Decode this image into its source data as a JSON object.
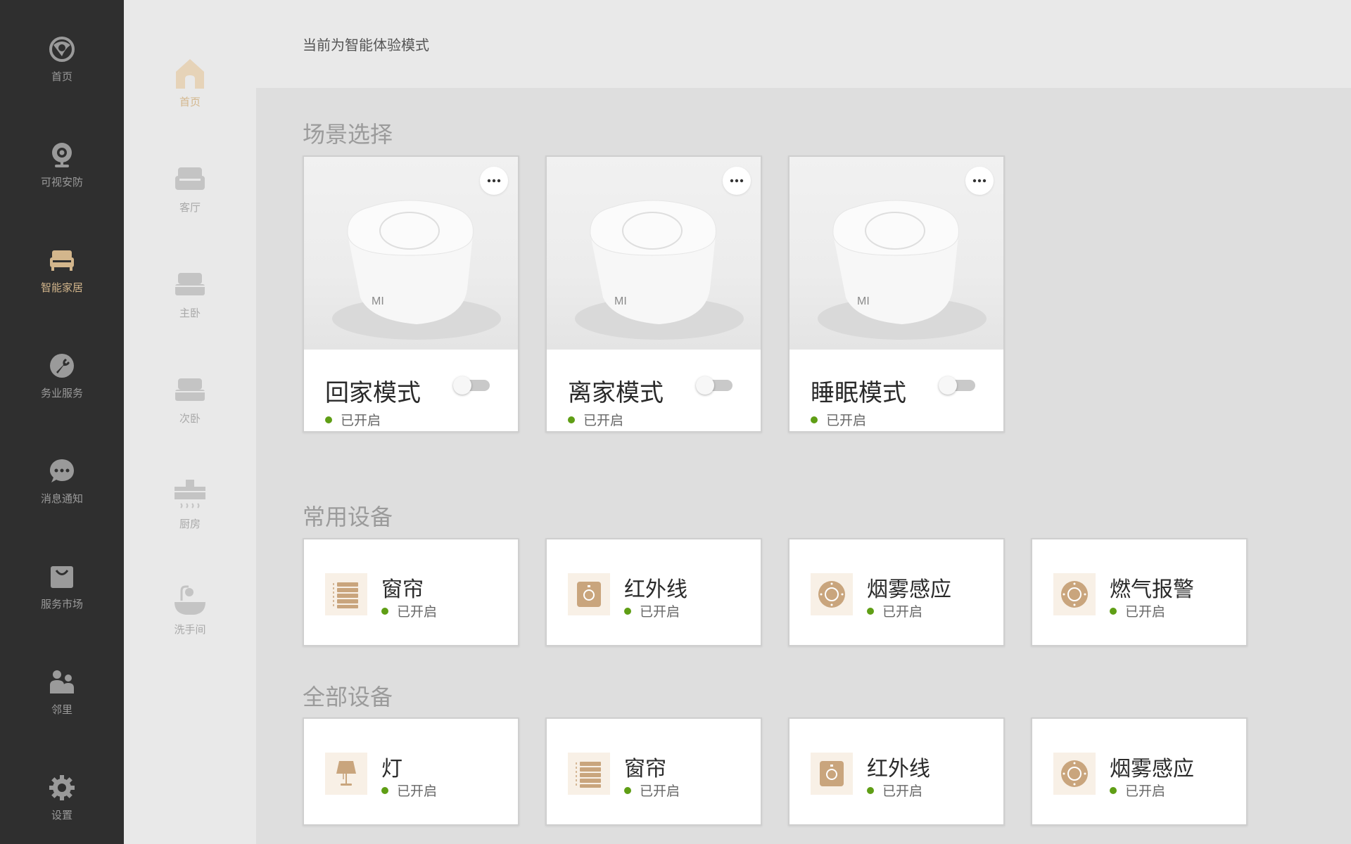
{
  "sidebar": {
    "items": [
      {
        "label": "首页",
        "icon": "home-logo-icon"
      },
      {
        "label": "可视安防",
        "icon": "camera-icon"
      },
      {
        "label": "智能家居",
        "icon": "sofa-icon",
        "active": true
      },
      {
        "label": "务业服务",
        "icon": "wrench-icon"
      },
      {
        "label": "消息通知",
        "icon": "chat-bubble-icon"
      },
      {
        "label": "服务市场",
        "icon": "shopping-bag-icon"
      },
      {
        "label": "邻里",
        "icon": "people-icon"
      },
      {
        "label": "设置",
        "icon": "gear-icon"
      }
    ]
  },
  "rooms": {
    "items": [
      {
        "label": "首页",
        "icon": "house-icon",
        "active": true
      },
      {
        "label": "客厅",
        "icon": "sofa-icon"
      },
      {
        "label": "主卧",
        "icon": "bed-icon"
      },
      {
        "label": "次卧",
        "icon": "bed-icon"
      },
      {
        "label": "厨房",
        "icon": "range-hood-icon"
      },
      {
        "label": "洗手间",
        "icon": "bathtub-icon"
      }
    ]
  },
  "header": {
    "mode_text": "当前为智能体验模式"
  },
  "sections": {
    "scenes_title": "场景选择",
    "common_title": "常用设备",
    "all_title": "全部设备"
  },
  "scenes": [
    {
      "name": "回家模式",
      "status": "已开启",
      "toggle_on": false
    },
    {
      "name": "离家模式",
      "status": "已开启",
      "toggle_on": false
    },
    {
      "name": "睡眠模式",
      "status": "已开启",
      "toggle_on": false
    }
  ],
  "common_devices": [
    {
      "name": "窗帘",
      "status": "已开启",
      "icon": "curtain-icon"
    },
    {
      "name": "红外线",
      "status": "已开启",
      "icon": "infrared-sensor-icon"
    },
    {
      "name": "烟雾感应",
      "status": "已开启",
      "icon": "smoke-detector-icon"
    },
    {
      "name": "燃气报警",
      "status": "已开启",
      "icon": "gas-alarm-icon"
    }
  ],
  "all_devices": [
    {
      "name": "灯",
      "status": "已开启",
      "icon": "lamp-icon"
    },
    {
      "name": "窗帘",
      "status": "已开启",
      "icon": "curtain-icon"
    },
    {
      "name": "红外线",
      "status": "已开启",
      "icon": "infrared-sensor-icon"
    },
    {
      "name": "烟雾感应",
      "status": "已开启",
      "icon": "smoke-detector-icon"
    }
  ],
  "colors": {
    "sidebar_bg": "#2f2f2f",
    "accent": "#d3b68c",
    "status_dot": "#5f9e15",
    "icon_bg": "#f8f0e6"
  }
}
